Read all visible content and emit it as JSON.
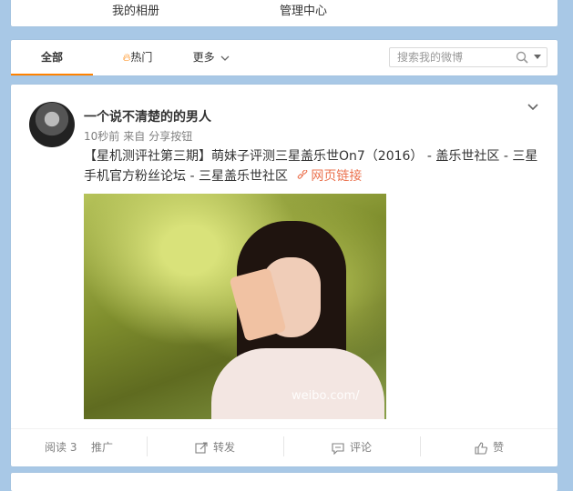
{
  "topbar": {
    "my_album": "我的相册",
    "admin_center": "管理中心"
  },
  "tabs": {
    "all": "全部",
    "hot": "热门",
    "more": "更多",
    "search_placeholder": "搜索我的微博"
  },
  "post": {
    "username": "一个说不清楚的的男人",
    "time": "10秒前",
    "source_prefix": "来自",
    "source": "分享按钮",
    "text": "【星机测评社第三期】萌妹子评测三星盖乐世On7（2016） - 盖乐世社区 - 三星手机官方粉丝论坛 - 三星盖乐世社区",
    "link_label": "网页链接",
    "image_watermark": "weibo.com/",
    "actions": {
      "reads": "阅读 3",
      "promote": "推广",
      "repost": "转发",
      "comment": "评论",
      "like": "赞"
    }
  },
  "colors": {
    "accent": "#ff8200",
    "link": "#eb7350",
    "background": "#a8c8e6"
  }
}
